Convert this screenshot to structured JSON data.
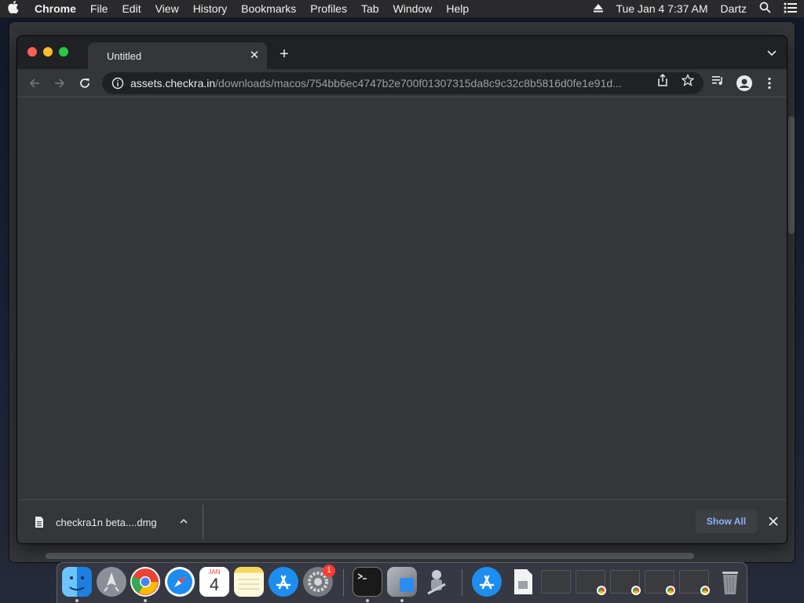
{
  "menubar": {
    "app_name": "Chrome",
    "menus": [
      "File",
      "Edit",
      "View",
      "History",
      "Bookmarks",
      "Profiles",
      "Tab",
      "Window",
      "Help"
    ],
    "datetime": "Tue Jan 4  7:37 AM",
    "user": "Dartz"
  },
  "browser": {
    "tab_title": "Untitled",
    "url_host": "assets.checkra.in",
    "url_path": "/downloads/macos/754bb6ec4747b2e700f01307315da8c9c32c8b5816d0fe1e91d..."
  },
  "download_shelf": {
    "file_name": "checkra1n beta....dmg",
    "show_all_label": "Show All"
  },
  "dock": {
    "calendar_month": "JAN",
    "calendar_day": "4",
    "system_prefs_badge": "1"
  },
  "colors": {
    "accent_link": "#8ab4f8",
    "window_bg": "#35363a",
    "tabstrip_bg": "#202124"
  }
}
